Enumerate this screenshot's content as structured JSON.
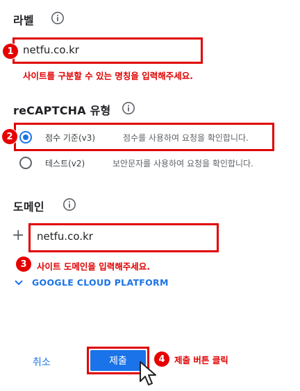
{
  "label_section": {
    "title": "라벨",
    "step": "1",
    "input_value": "netfu.co.kr",
    "hint": "사이트를 구분할 수 있는 명칭을 입력해주세요."
  },
  "recaptcha_section": {
    "title": "reCAPTCHA 유형",
    "step": "2",
    "options": [
      {
        "label": "점수 기준(v3)",
        "desc": "점수를 사용하여 요청을 확인합니다.",
        "selected": true
      },
      {
        "label": "테스트(v2)",
        "desc": "보안문자를 사용하여 요청을 확인합니다.",
        "selected": false
      }
    ]
  },
  "domain_section": {
    "title": "도메인",
    "step": "3",
    "plus_symbol": "+",
    "input_value": "netfu.co.kr",
    "hint": "사이트 도메인을 입력해주세요.",
    "gcp_link": "GOOGLE CLOUD PLATFORM"
  },
  "footer": {
    "cancel_label": "취소",
    "submit_label": "제출",
    "step": "4",
    "submit_hint": "제출 버튼 클릭"
  },
  "colors": {
    "accent": "#1a73e8",
    "annotation_red": "#e00000"
  },
  "icons": [
    "info-icon",
    "chevron-down-icon",
    "mouse-cursor-icon"
  ]
}
